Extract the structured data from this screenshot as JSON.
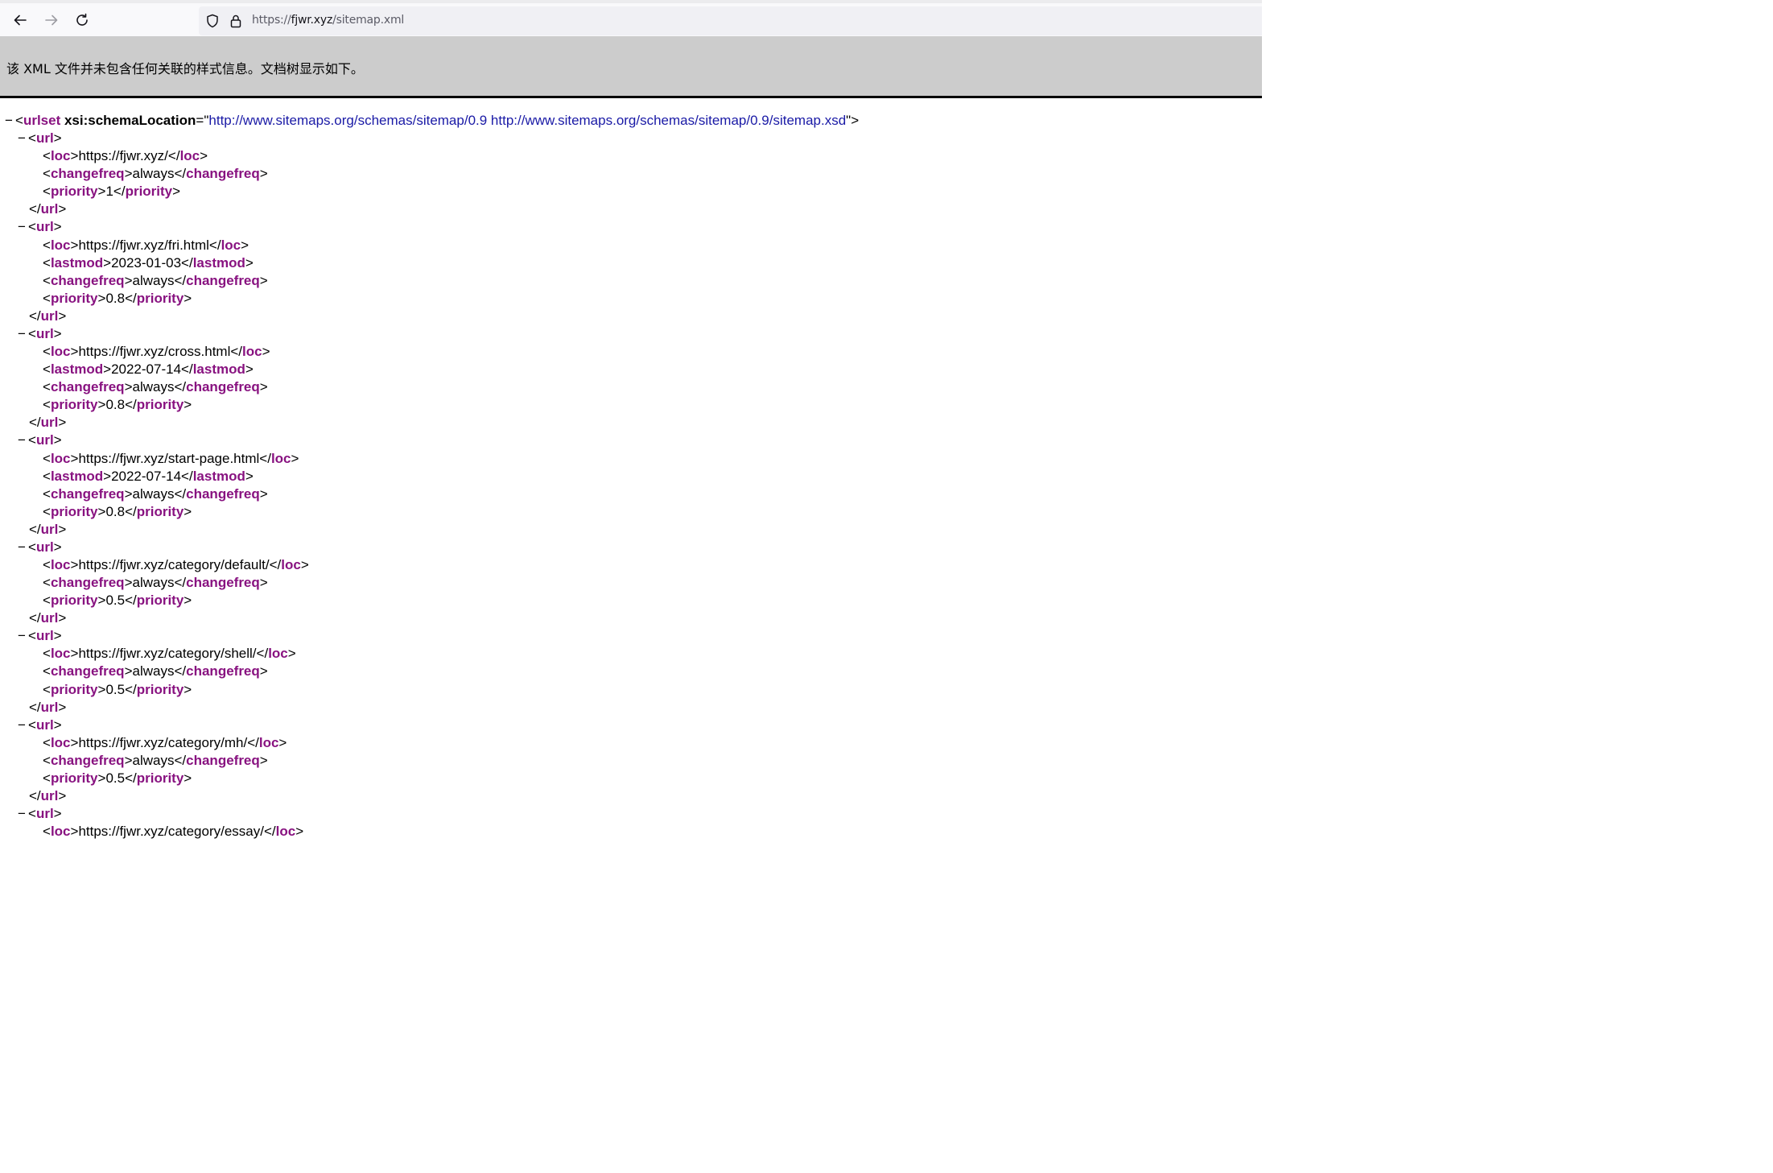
{
  "browser": {
    "url_scheme": "https://",
    "url_host": "fjwr.xyz",
    "url_path": "/sitemap.xml"
  },
  "banner": {
    "message": "该 XML 文件并未包含任何关联的样式信息。文档树显示如下。"
  },
  "xml": {
    "fold_symbol": "−",
    "root": {
      "tag": "urlset",
      "attr_name": "xsi:schemaLocation",
      "attr_value": "http://www.sitemaps.org/schemas/sitemap/0.9 http://www.sitemaps.org/schemas/sitemap/0.9/sitemap.xsd"
    },
    "entries": [
      {
        "loc": "https://fjwr.xyz/",
        "changefreq": "always",
        "priority": "1"
      },
      {
        "loc": "https://fjwr.xyz/fri.html",
        "lastmod": "2023-01-03",
        "changefreq": "always",
        "priority": "0.8"
      },
      {
        "loc": "https://fjwr.xyz/cross.html",
        "lastmod": "2022-07-14",
        "changefreq": "always",
        "priority": "0.8"
      },
      {
        "loc": "https://fjwr.xyz/start-page.html",
        "lastmod": "2022-07-14",
        "changefreq": "always",
        "priority": "0.8"
      },
      {
        "loc": "https://fjwr.xyz/category/default/",
        "changefreq": "always",
        "priority": "0.5"
      },
      {
        "loc": "https://fjwr.xyz/category/shell/",
        "changefreq": "always",
        "priority": "0.5"
      },
      {
        "loc": "https://fjwr.xyz/category/mh/",
        "changefreq": "always",
        "priority": "0.5"
      },
      {
        "loc": "https://fjwr.xyz/category/essay/"
      }
    ]
  }
}
